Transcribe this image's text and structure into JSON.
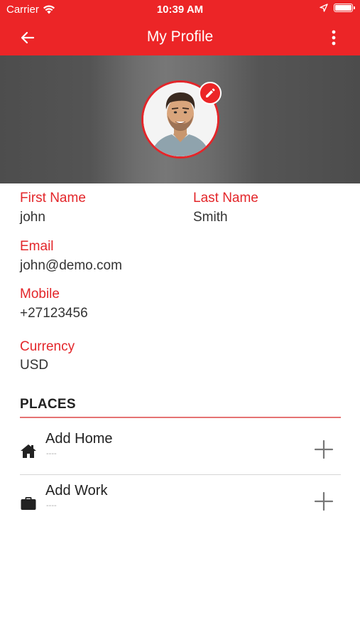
{
  "status_bar": {
    "carrier": "Carrier",
    "time": "10:39 AM"
  },
  "app_bar": {
    "title": "My Profile"
  },
  "profile": {
    "first_name_label": "First Name",
    "first_name": "john",
    "last_name_label": "Last Name",
    "last_name": "Smith",
    "email_label": "Email",
    "email": "john@demo.com",
    "mobile_label": "Mobile",
    "mobile": "+27123456",
    "currency_label": "Currency",
    "currency": "USD"
  },
  "places": {
    "heading": "PLACES",
    "items": [
      {
        "label": "Add Home",
        "sub": "----",
        "icon": "home-icon"
      },
      {
        "label": "Add Work",
        "sub": "----",
        "icon": "briefcase-icon"
      }
    ]
  },
  "colors": {
    "accent": "#ec2527",
    "label": "#e3262a",
    "header_bg": "#555555"
  }
}
